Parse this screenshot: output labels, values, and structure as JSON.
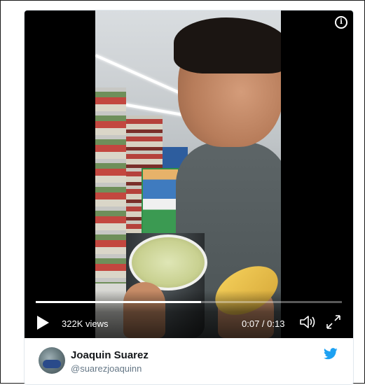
{
  "video": {
    "views": "322K views",
    "time": "0:07 / 0:13",
    "progress": 0.54,
    "controls": {
      "play_icon": "play-icon",
      "volume_icon": "volume-icon",
      "fullscreen_icon": "fullscreen-icon",
      "info_icon": "info-icon"
    }
  },
  "author": {
    "name": "Joaquin Suarez",
    "handle": "@suarezjoaquinn",
    "logo_icon": "twitter-logo-icon"
  },
  "colors": {
    "twitter_blue": "#1da1f2",
    "handle_gray": "#657786"
  }
}
